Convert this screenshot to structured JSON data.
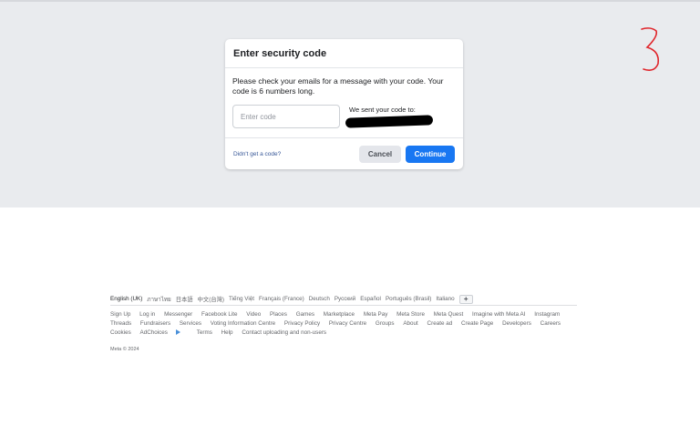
{
  "dialog": {
    "title": "Enter security code",
    "message": "Please check your emails for a message with your code. Your code is 6 numbers long.",
    "input_placeholder": "Enter code",
    "input_value": "",
    "sent_to_label": "We sent your code to:",
    "no_code_link": "Didn't get a code?",
    "cancel_label": "Cancel",
    "continue_label": "Continue"
  },
  "annotation": {
    "label": "3",
    "color": "#e0242a"
  },
  "footer": {
    "current_language": "English (UK)",
    "languages": [
      "ภาษาไทย",
      "日本語",
      "中文(台灣)",
      "Tiếng Việt",
      "Français (France)",
      "Deutsch",
      "Русский",
      "Español",
      "Português (Brasil)",
      "Italiano"
    ],
    "more_languages_label": "+",
    "links": [
      "Sign Up",
      "Log in",
      "Messenger",
      "Facebook Lite",
      "Video",
      "Places",
      "Games",
      "Marketplace",
      "Meta Pay",
      "Meta Store",
      "Meta Quest",
      "Imagine with Meta AI",
      "Instagram",
      "Threads",
      "Fundraisers",
      "Services",
      "Voting Information Centre",
      "Privacy Policy",
      "Privacy Centre",
      "Groups",
      "About",
      "Create ad",
      "Create Page",
      "Developers",
      "Careers",
      "Cookies",
      "AdChoices",
      "Terms",
      "Help",
      "Contact uploading and non-users"
    ],
    "copyright": "Meta © 2024"
  },
  "colors": {
    "primary_button": "#1877f2",
    "background_band": "#e9ebee",
    "link": "#385898"
  }
}
